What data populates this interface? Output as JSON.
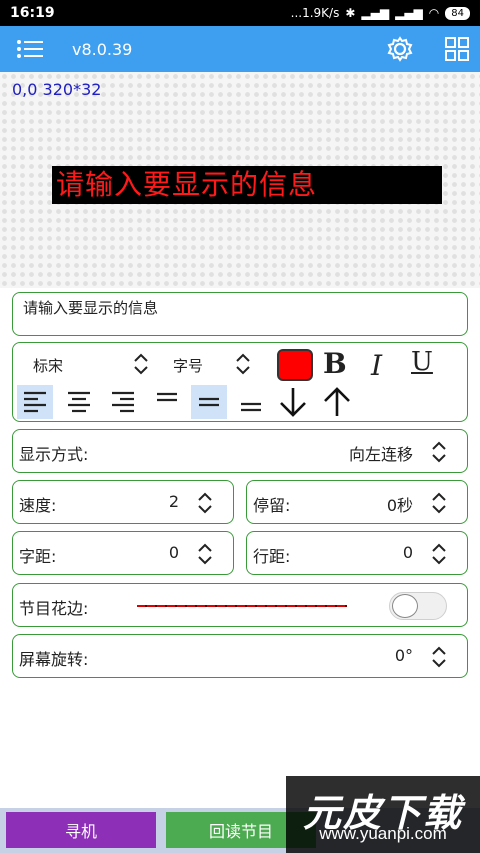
{
  "status": {
    "time": "16:19",
    "net_speed": "...1.9K/s",
    "battery": "84"
  },
  "app_bar": {
    "version": "v8.0.39"
  },
  "preview": {
    "coords": "0,0 320*32",
    "led_text": "请输入要显示的信息",
    "led_color": "#ff1a1a"
  },
  "message": {
    "value": "请输入要显示的信息"
  },
  "format": {
    "font_name": "标宋",
    "font_size_label": "字号",
    "color": "#ff0000",
    "bold": "B",
    "italic": "I",
    "underline": "U"
  },
  "display_mode": {
    "label": "显示方式:",
    "value": "向左连移"
  },
  "speed": {
    "label": "速度:",
    "value": "2"
  },
  "stay": {
    "label": "停留:",
    "value": "0秒"
  },
  "char_spacing": {
    "label": "字距:",
    "value": "0"
  },
  "line_spacing": {
    "label": "行距:",
    "value": "0"
  },
  "border": {
    "label": "节目花边:",
    "enabled": false
  },
  "rotation": {
    "label": "屏幕旋转:",
    "value": "0°"
  },
  "bottom": {
    "search_label": "寻机",
    "search_color": "#8e2fb8",
    "readback_label": "回读节目",
    "readback_color": "#4caa50"
  },
  "watermark": {
    "logo": "元皮下载",
    "url": "www.yuanpi.com"
  }
}
